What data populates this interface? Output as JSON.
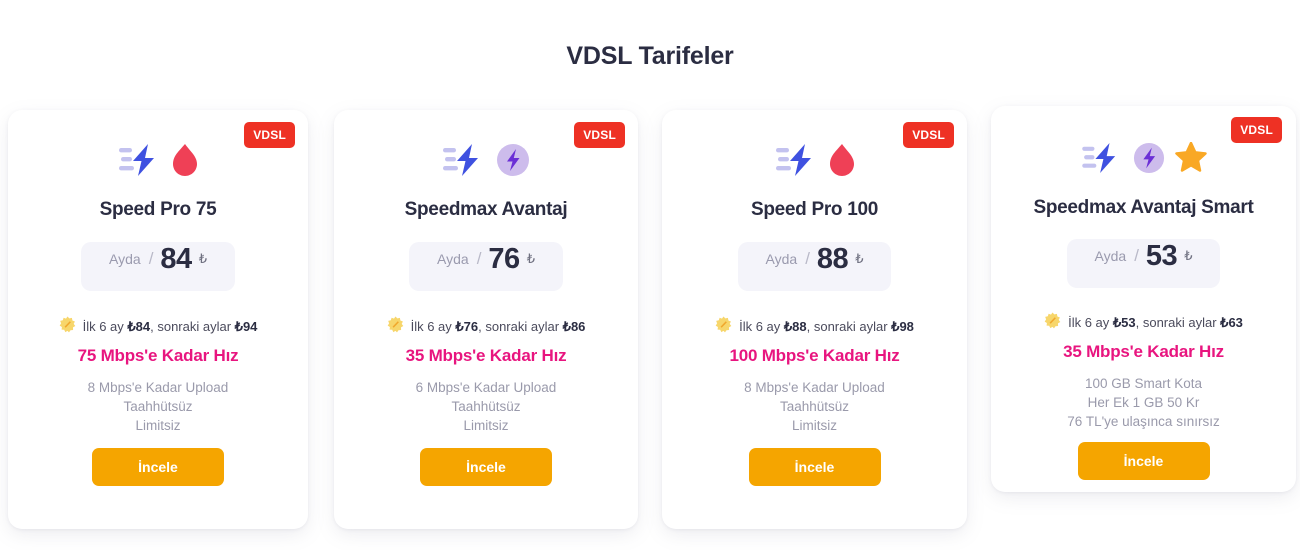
{
  "page": {
    "title": "VDSL Tarifeler",
    "background": "#ffffff"
  },
  "colors": {
    "badge": "#ee3124",
    "cta": "#f5a500",
    "speed_text": "#e8157f",
    "title_text": "#2b2d42",
    "muted_text": "#9a9aab",
    "price_pill_bg": "#f4f4fa"
  },
  "cards": [
    {
      "badge": "VDSL",
      "icons": [
        "speed-bolt-icon",
        "flame-icon"
      ],
      "name": "Speed Pro 75",
      "price": {
        "per_label": "Ayda",
        "separator": "/",
        "amount": "84",
        "currency": "₺"
      },
      "promo": {
        "icon": "sparkle-badge-icon",
        "prefix": "İlk 6 ay ",
        "first_price": "₺84",
        "middle": ", sonraki aylar ",
        "later_price": "₺94"
      },
      "speed": "75 Mbps'e Kadar Hız",
      "features": [
        "8 Mbps'e Kadar Upload",
        "Taahhütsüz",
        "Limitsiz"
      ],
      "cta": "İncele"
    },
    {
      "badge": "VDSL",
      "icons": [
        "speed-bolt-icon",
        "purple-bolt-circle-icon"
      ],
      "name": "Speedmax Avantaj",
      "price": {
        "per_label": "Ayda",
        "separator": "/",
        "amount": "76",
        "currency": "₺"
      },
      "promo": {
        "icon": "sparkle-badge-icon",
        "prefix": "İlk 6 ay ",
        "first_price": "₺76",
        "middle": ", sonraki aylar ",
        "later_price": "₺86"
      },
      "speed": "35 Mbps'e Kadar Hız",
      "features": [
        "6 Mbps'e Kadar Upload",
        "Taahhütsüz",
        "Limitsiz"
      ],
      "cta": "İncele"
    },
    {
      "badge": "VDSL",
      "icons": [
        "speed-bolt-icon",
        "flame-icon"
      ],
      "name": "Speed Pro 100",
      "price": {
        "per_label": "Ayda",
        "separator": "/",
        "amount": "88",
        "currency": "₺"
      },
      "promo": {
        "icon": "sparkle-badge-icon",
        "prefix": "İlk 6 ay ",
        "first_price": "₺88",
        "middle": ", sonraki aylar ",
        "later_price": "₺98"
      },
      "speed": "100 Mbps'e Kadar Hız",
      "features": [
        "8 Mbps'e Kadar Upload",
        "Taahhütsüz",
        "Limitsiz"
      ],
      "cta": "İncele"
    },
    {
      "badge": "VDSL",
      "icons": [
        "speed-bolt-icon",
        "purple-bolt-circle-icon",
        "star-icon"
      ],
      "name": "Speedmax Avantaj Smart",
      "price": {
        "per_label": "Ayda",
        "separator": "/",
        "amount": "53",
        "currency": "₺"
      },
      "promo": {
        "icon": "sparkle-badge-icon",
        "prefix": "İlk 6 ay ",
        "first_price": "₺53",
        "middle": ", sonraki aylar ",
        "later_price": "₺63"
      },
      "speed": "35 Mbps'e Kadar Hız",
      "features": [
        "100 GB Smart Kota",
        "Her Ek 1 GB 50 Kr",
        "76 TL'ye ulaşınca sınırsız"
      ],
      "cta": "İncele"
    }
  ]
}
